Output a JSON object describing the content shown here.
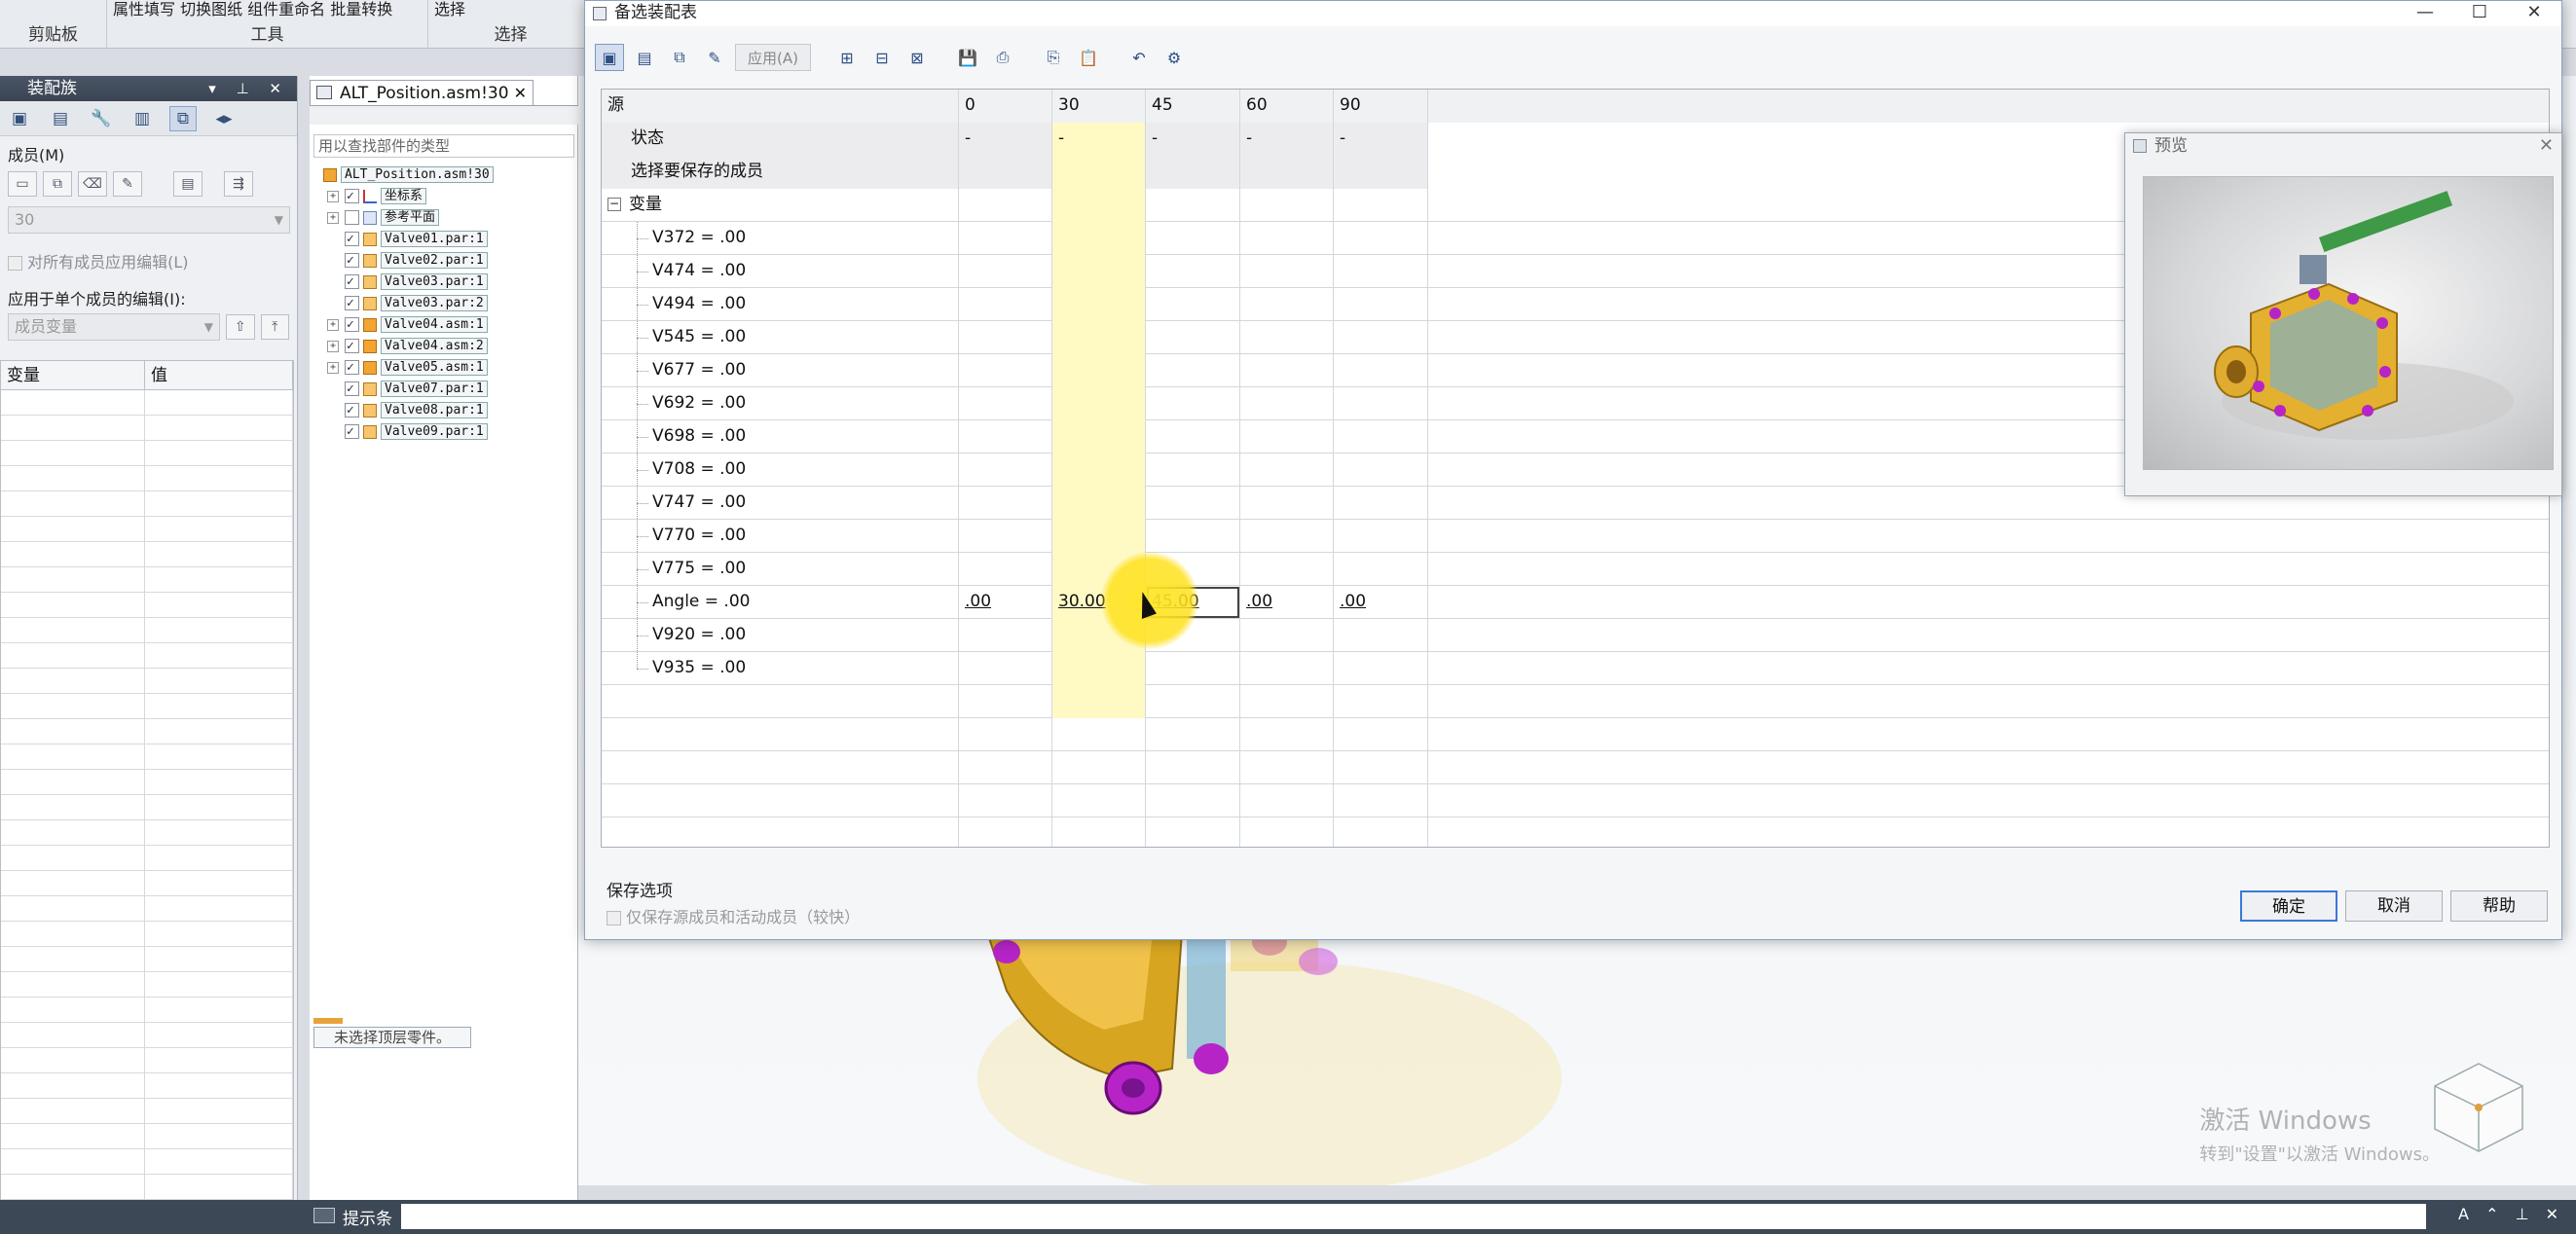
{
  "ribbon": {
    "groups": [
      {
        "top": "",
        "caption": "剪贴板"
      },
      {
        "top": "属性填写  切换图纸  组件重命名  批量转换",
        "caption": "工具"
      },
      {
        "top": "选择",
        "caption": "选择"
      }
    ]
  },
  "left_panel": {
    "title": "装配族",
    "members_label": "成员(M)",
    "member_select": "30",
    "apply_all_label": "对所有成员应用编辑(L)",
    "apply_single_label": "应用于单个成员的编辑(I):",
    "edit_type_select": "成员变量",
    "grid_headers": [
      "变量",
      "值"
    ]
  },
  "tree": {
    "tab_title": "ALT_Position.asm!30",
    "search_placeholder": "用以查找部件的类型",
    "root": "ALT_Position.asm!30",
    "items": [
      {
        "label": "坐标系",
        "type": "axis",
        "expand": "+",
        "checked": true
      },
      {
        "label": "参考平面",
        "type": "plane",
        "expand": "+",
        "checked": false
      },
      {
        "label": "Valve01.par:1",
        "type": "par",
        "expand": "",
        "checked": true
      },
      {
        "label": "Valve02.par:1",
        "type": "par",
        "expand": "",
        "checked": true
      },
      {
        "label": "Valve03.par:1",
        "type": "par",
        "expand": "",
        "checked": true
      },
      {
        "label": "Valve03.par:2",
        "type": "par",
        "expand": "",
        "checked": true
      },
      {
        "label": "Valve04.asm:1",
        "type": "asm",
        "expand": "+",
        "checked": true
      },
      {
        "label": "Valve04.asm:2",
        "type": "asm",
        "expand": "+",
        "checked": true
      },
      {
        "label": "Valve05.asm:1",
        "type": "asm",
        "expand": "+",
        "checked": true
      },
      {
        "label": "Valve07.par:1",
        "type": "par",
        "expand": "",
        "checked": true
      },
      {
        "label": "Valve08.par:1",
        "type": "par",
        "expand": "",
        "checked": true
      },
      {
        "label": "Valve09.par:1",
        "type": "par",
        "expand": "",
        "checked": true
      }
    ],
    "status_tag": "未选择顶层零件。"
  },
  "dialog": {
    "title": "备选装配表",
    "apply_button": "应用(A)",
    "table": {
      "headers": [
        "源",
        "0",
        "30",
        "45",
        "60",
        "90"
      ],
      "state_label": "状态",
      "state_values": [
        "-",
        "-",
        "-",
        "-",
        "-"
      ],
      "select_label": "选择要保存的成员",
      "group_label": "变量",
      "group_toggle": "−",
      "variables": [
        {
          "name": "V372 =  .00",
          "values": [
            "",
            "",
            "",
            "",
            ""
          ]
        },
        {
          "name": "V474 =  .00",
          "values": [
            "",
            "",
            "",
            "",
            ""
          ]
        },
        {
          "name": "V494 =  .00",
          "values": [
            "",
            "",
            "",
            "",
            ""
          ]
        },
        {
          "name": "V545 =  .00",
          "values": [
            "",
            "",
            "",
            "",
            ""
          ]
        },
        {
          "name": "V677 =  .00",
          "values": [
            "",
            "",
            "",
            "",
            ""
          ]
        },
        {
          "name": "V692 =  .00",
          "values": [
            "",
            "",
            "",
            "",
            ""
          ]
        },
        {
          "name": "V698 =  .00",
          "values": [
            "",
            "",
            "",
            "",
            ""
          ]
        },
        {
          "name": "V708 =  .00",
          "values": [
            "",
            "",
            "",
            "",
            ""
          ]
        },
        {
          "name": "V747 =  .00",
          "values": [
            "",
            "",
            "",
            "",
            ""
          ]
        },
        {
          "name": "V770 =  .00",
          "values": [
            "",
            "",
            "",
            "",
            ""
          ]
        },
        {
          "name": "V775 =  .00",
          "values": [
            "",
            "",
            "",
            "",
            ""
          ]
        },
        {
          "name": "Angle =  .00",
          "values": [
            ".00",
            "30.00",
            "45.00",
            ".00",
            ".00"
          ]
        },
        {
          "name": "V920 =  .00",
          "values": [
            "",
            "",
            "",
            "",
            ""
          ]
        },
        {
          "name": "V935 =  .00",
          "values": [
            "",
            "",
            "",
            "",
            ""
          ]
        }
      ]
    },
    "save_options_label": "保存选项",
    "save_options_check": "仅保存源成员和活动成员（较快）",
    "ok": "确定",
    "cancel": "取消",
    "help": "帮助"
  },
  "preview": {
    "title": "预览"
  },
  "watermark": {
    "line1": "激活 Windows",
    "line2": "转到\"设置\"以激活 Windows。"
  },
  "statusbar": {
    "label": "提示条"
  },
  "colors": {
    "highlight_column": "#fff9c4",
    "cursor_glow": "#ffe628",
    "accent": "#3b78d8"
  }
}
